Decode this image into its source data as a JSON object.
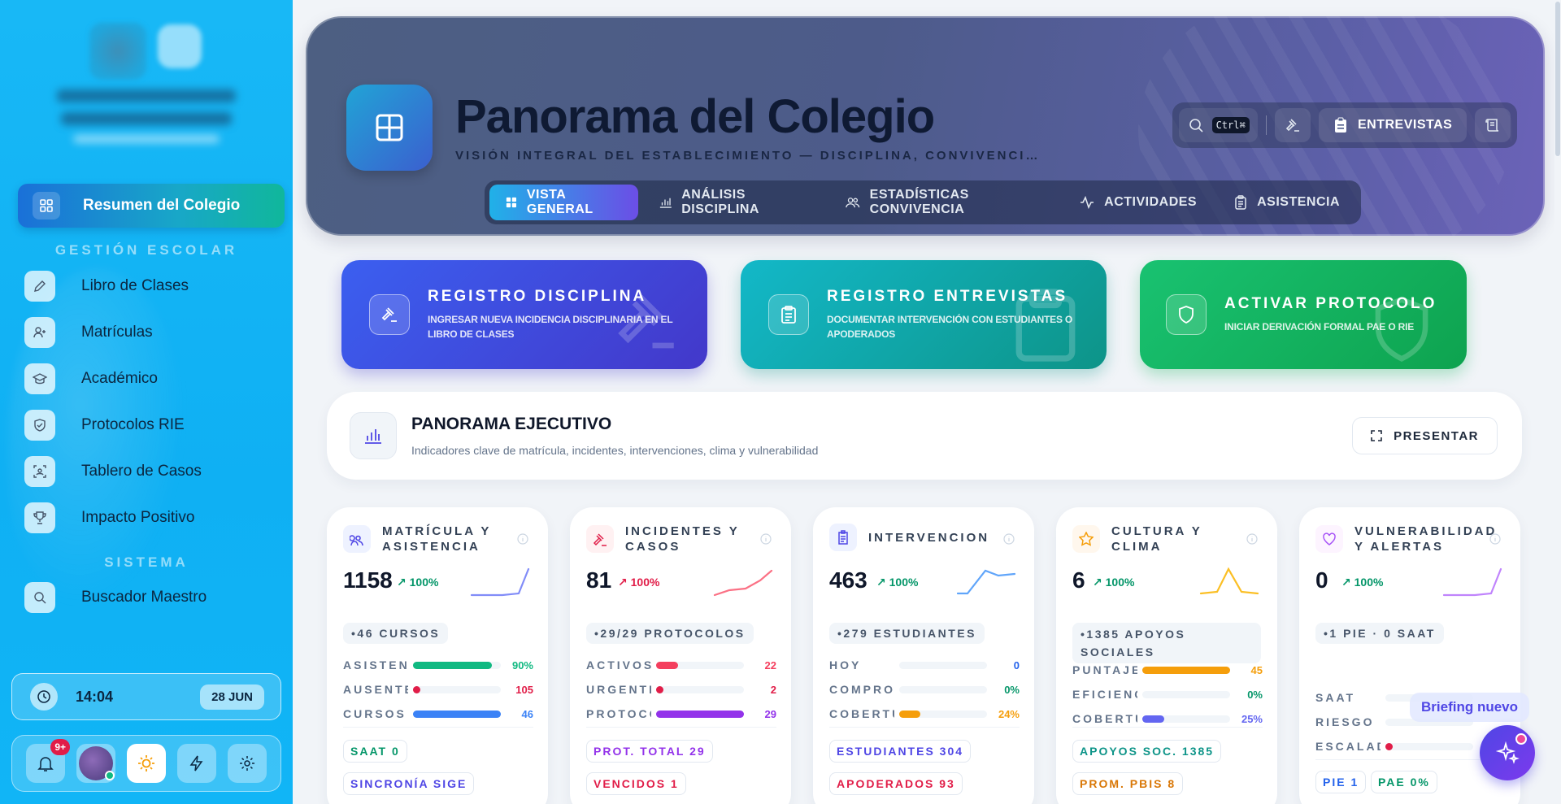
{
  "sidebar": {
    "active_item": "Resumen del Colegio",
    "section_school": "GESTIÓN ESCOLAR",
    "items": [
      "Libro de Clases",
      "Matrículas",
      "Académico",
      "Protocolos RIE",
      "Tablero de Casos",
      "Impacto Positivo"
    ],
    "section_system": "SISTEMA",
    "system_items": [
      "Buscador Maestro"
    ],
    "clock": {
      "time": "14:04",
      "date": "28 JUN"
    },
    "notifications_badge": "9+"
  },
  "header": {
    "title": "Panorama del Colegio",
    "subtitle": "VISIÓN INTEGRAL DEL ESTABLECIMIENTO — DISCIPLINA, CONVIVENCI…",
    "search_kbd": "Ctrl⌘",
    "interviews_label": "ENTREVISTAS",
    "tabs": [
      "VISTA GENERAL",
      "ANÁLISIS DISCIPLINA",
      "ESTADÍSTICAS CONVIVENCIA",
      "ACTIVIDADES",
      "ASISTENCIA"
    ]
  },
  "actions": [
    {
      "title": "REGISTRO DISCIPLINA",
      "subtitle_1": "INGRESAR NUEVA INCIDENCIA DISCIPLINARIA EN EL",
      "subtitle_2": "LIBRO DE CLASES",
      "color": "#3b46e6"
    },
    {
      "title": "REGISTRO ENTREVISTAS",
      "subtitle_1": "DOCUMENTAR INTERVENCIÓN CON ESTUDIANTES O",
      "subtitle_2": "APODERADOS",
      "color": "#0fa7b5"
    },
    {
      "title": "ACTIVAR PROTOCOLO",
      "subtitle_1": "INICIAR DERIVACIÓN FORMAL PAE O RIE",
      "subtitle_2": "",
      "color": "#10b35a"
    }
  ],
  "executive": {
    "title": "PANORAMA EJECUTIVO",
    "subtitle": "Indicadores clave de matrícula, incidentes, intervenciones, clima y vulnerabilidad",
    "present_label": "PRESENTAR"
  },
  "cards": [
    {
      "title": "MATRÍCULA Y ASISTENCIA",
      "value": "1158",
      "delta": "↗ 100%",
      "delta_color": "#059669",
      "pill": "•46 CURSOS",
      "rows": [
        {
          "label": "ASISTENCIA",
          "value": "90%",
          "fill": 0.9,
          "color": "#10b981"
        },
        {
          "label": "AUSENTES",
          "value": "105",
          "fill": 0.05,
          "color": "#e11d48"
        },
        {
          "label": "CURSOS",
          "value": "46",
          "fill": 1.0,
          "color": "#3b82f6"
        }
      ],
      "tags": [
        {
          "text": "SAAT 0",
          "color": "#059669"
        },
        {
          "text": "SINCRONÍA SIGE",
          "color": "#4f46e5"
        }
      ]
    },
    {
      "title": "INCIDENTES Y CASOS",
      "value": "81",
      "delta": "↗ 100%",
      "delta_color": "#e11d48",
      "pill": "•29/29 PROTOCOLOS",
      "rows": [
        {
          "label": "ACTIVOS",
          "value": "22",
          "fill": 0.25,
          "color": "#f43f5e"
        },
        {
          "label": "URGENTES",
          "value": "2",
          "fill": 0.05,
          "color": "#e11d48"
        },
        {
          "label": "PROTOCOLOS",
          "value": "29",
          "fill": 1.0,
          "color": "#9333ea"
        }
      ],
      "tags": [
        {
          "text": "PROT. TOTAL 29",
          "color": "#9333ea"
        },
        {
          "text": "VENCIDOS 1",
          "color": "#e11d48"
        }
      ]
    },
    {
      "title": "INTERVENCION",
      "value": "463",
      "delta": "↗ 100%",
      "delta_color": "#059669",
      "pill": "•279 ESTUDIANTES",
      "rows": [
        {
          "label": "HOY",
          "value": "0",
          "fill": 0.0,
          "color": "#2563eb"
        },
        {
          "label": "COMPROMISOS",
          "value": "0%",
          "fill": 0.0,
          "color": "#059669"
        },
        {
          "label": "COBERTURA",
          "value": "24%",
          "fill": 0.24,
          "color": "#f59e0b"
        }
      ],
      "tags": [
        {
          "text": "ESTUDIANTES 304",
          "color": "#4f46e5"
        },
        {
          "text": "APODERADOS 93",
          "color": "#e11d48"
        }
      ]
    },
    {
      "title": "CULTURA Y CLIMA",
      "value": "6",
      "delta": "↗ 100%",
      "delta_color": "#059669",
      "pill": "•1385 APOYOS SOCIALES",
      "rows": [
        {
          "label": "PUNTAJE",
          "value": "45",
          "fill": 1.0,
          "color": "#f59e0b"
        },
        {
          "label": "EFICIENCIA",
          "value": "0%",
          "fill": 0.0,
          "color": "#059669"
        },
        {
          "label": "COBERTURA",
          "value": "25%",
          "fill": 0.25,
          "color": "#6366f1"
        }
      ],
      "tags": [
        {
          "text": "APOYOS SOC. 1385",
          "color": "#0d9488"
        },
        {
          "text": "PROM. PBIS 8",
          "color": "#d97706"
        }
      ]
    },
    {
      "title": "VULNERABILIDAD Y ALERTAS",
      "value": "0",
      "delta": "↗ 100%",
      "delta_color": "#059669",
      "pill": "•1 PIE · 0 SAAT",
      "rows": [
        {
          "label": "SAAT",
          "value": "",
          "fill": 0.0,
          "color": "#e11d48"
        },
        {
          "label": "RIESGO",
          "value": "",
          "fill": 0.0,
          "color": "#e11d48"
        },
        {
          "label": "ESCALADOS",
          "value": "",
          "fill": 0.04,
          "color": "#e11d48"
        }
      ],
      "tags": [
        {
          "text": "PIE 1",
          "color": "#2563eb"
        },
        {
          "text": "PAE 0%",
          "color": "#059669"
        }
      ]
    }
  ],
  "briefing_label": "Briefing nuevo"
}
